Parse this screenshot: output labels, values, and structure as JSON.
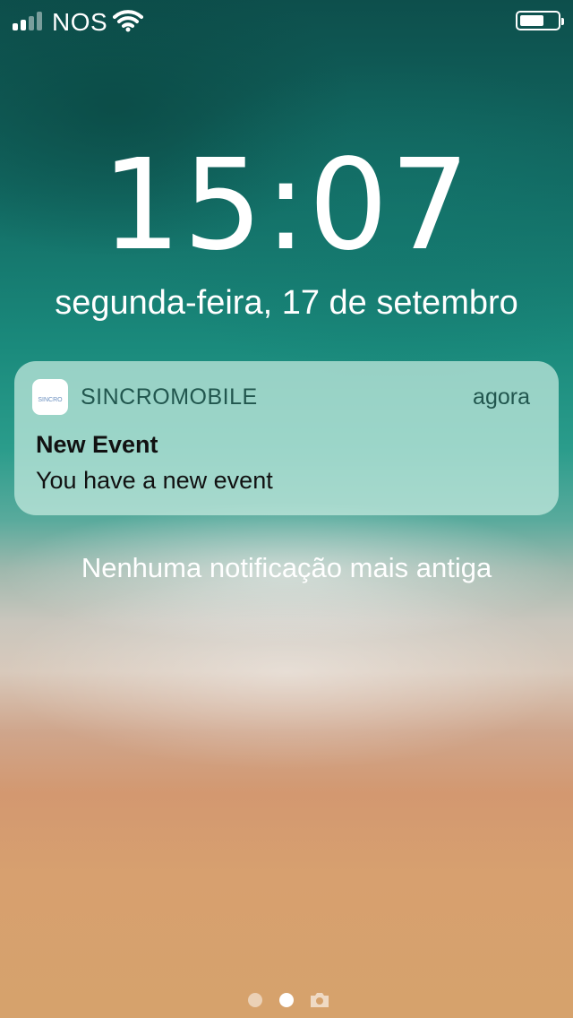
{
  "status_bar": {
    "carrier": "NOS",
    "signal_bars_active": 2,
    "signal_bars_total": 4,
    "wifi_icon": "wifi-icon",
    "battery_level": 0.62
  },
  "lock_screen": {
    "time": "15:07",
    "date": "segunda-feira, 17 de setembro"
  },
  "notification": {
    "app_icon": "sincro-app-icon",
    "app_icon_text": "SINCRO",
    "app_name": "SINCROMOBILE",
    "time": "agora",
    "title": "New Event",
    "body": "You have a new event"
  },
  "no_older_notifications": "Nenhuma notificação mais antiga",
  "page_indicator": {
    "pages": 2,
    "current": 2,
    "camera_icon": "camera-icon"
  }
}
